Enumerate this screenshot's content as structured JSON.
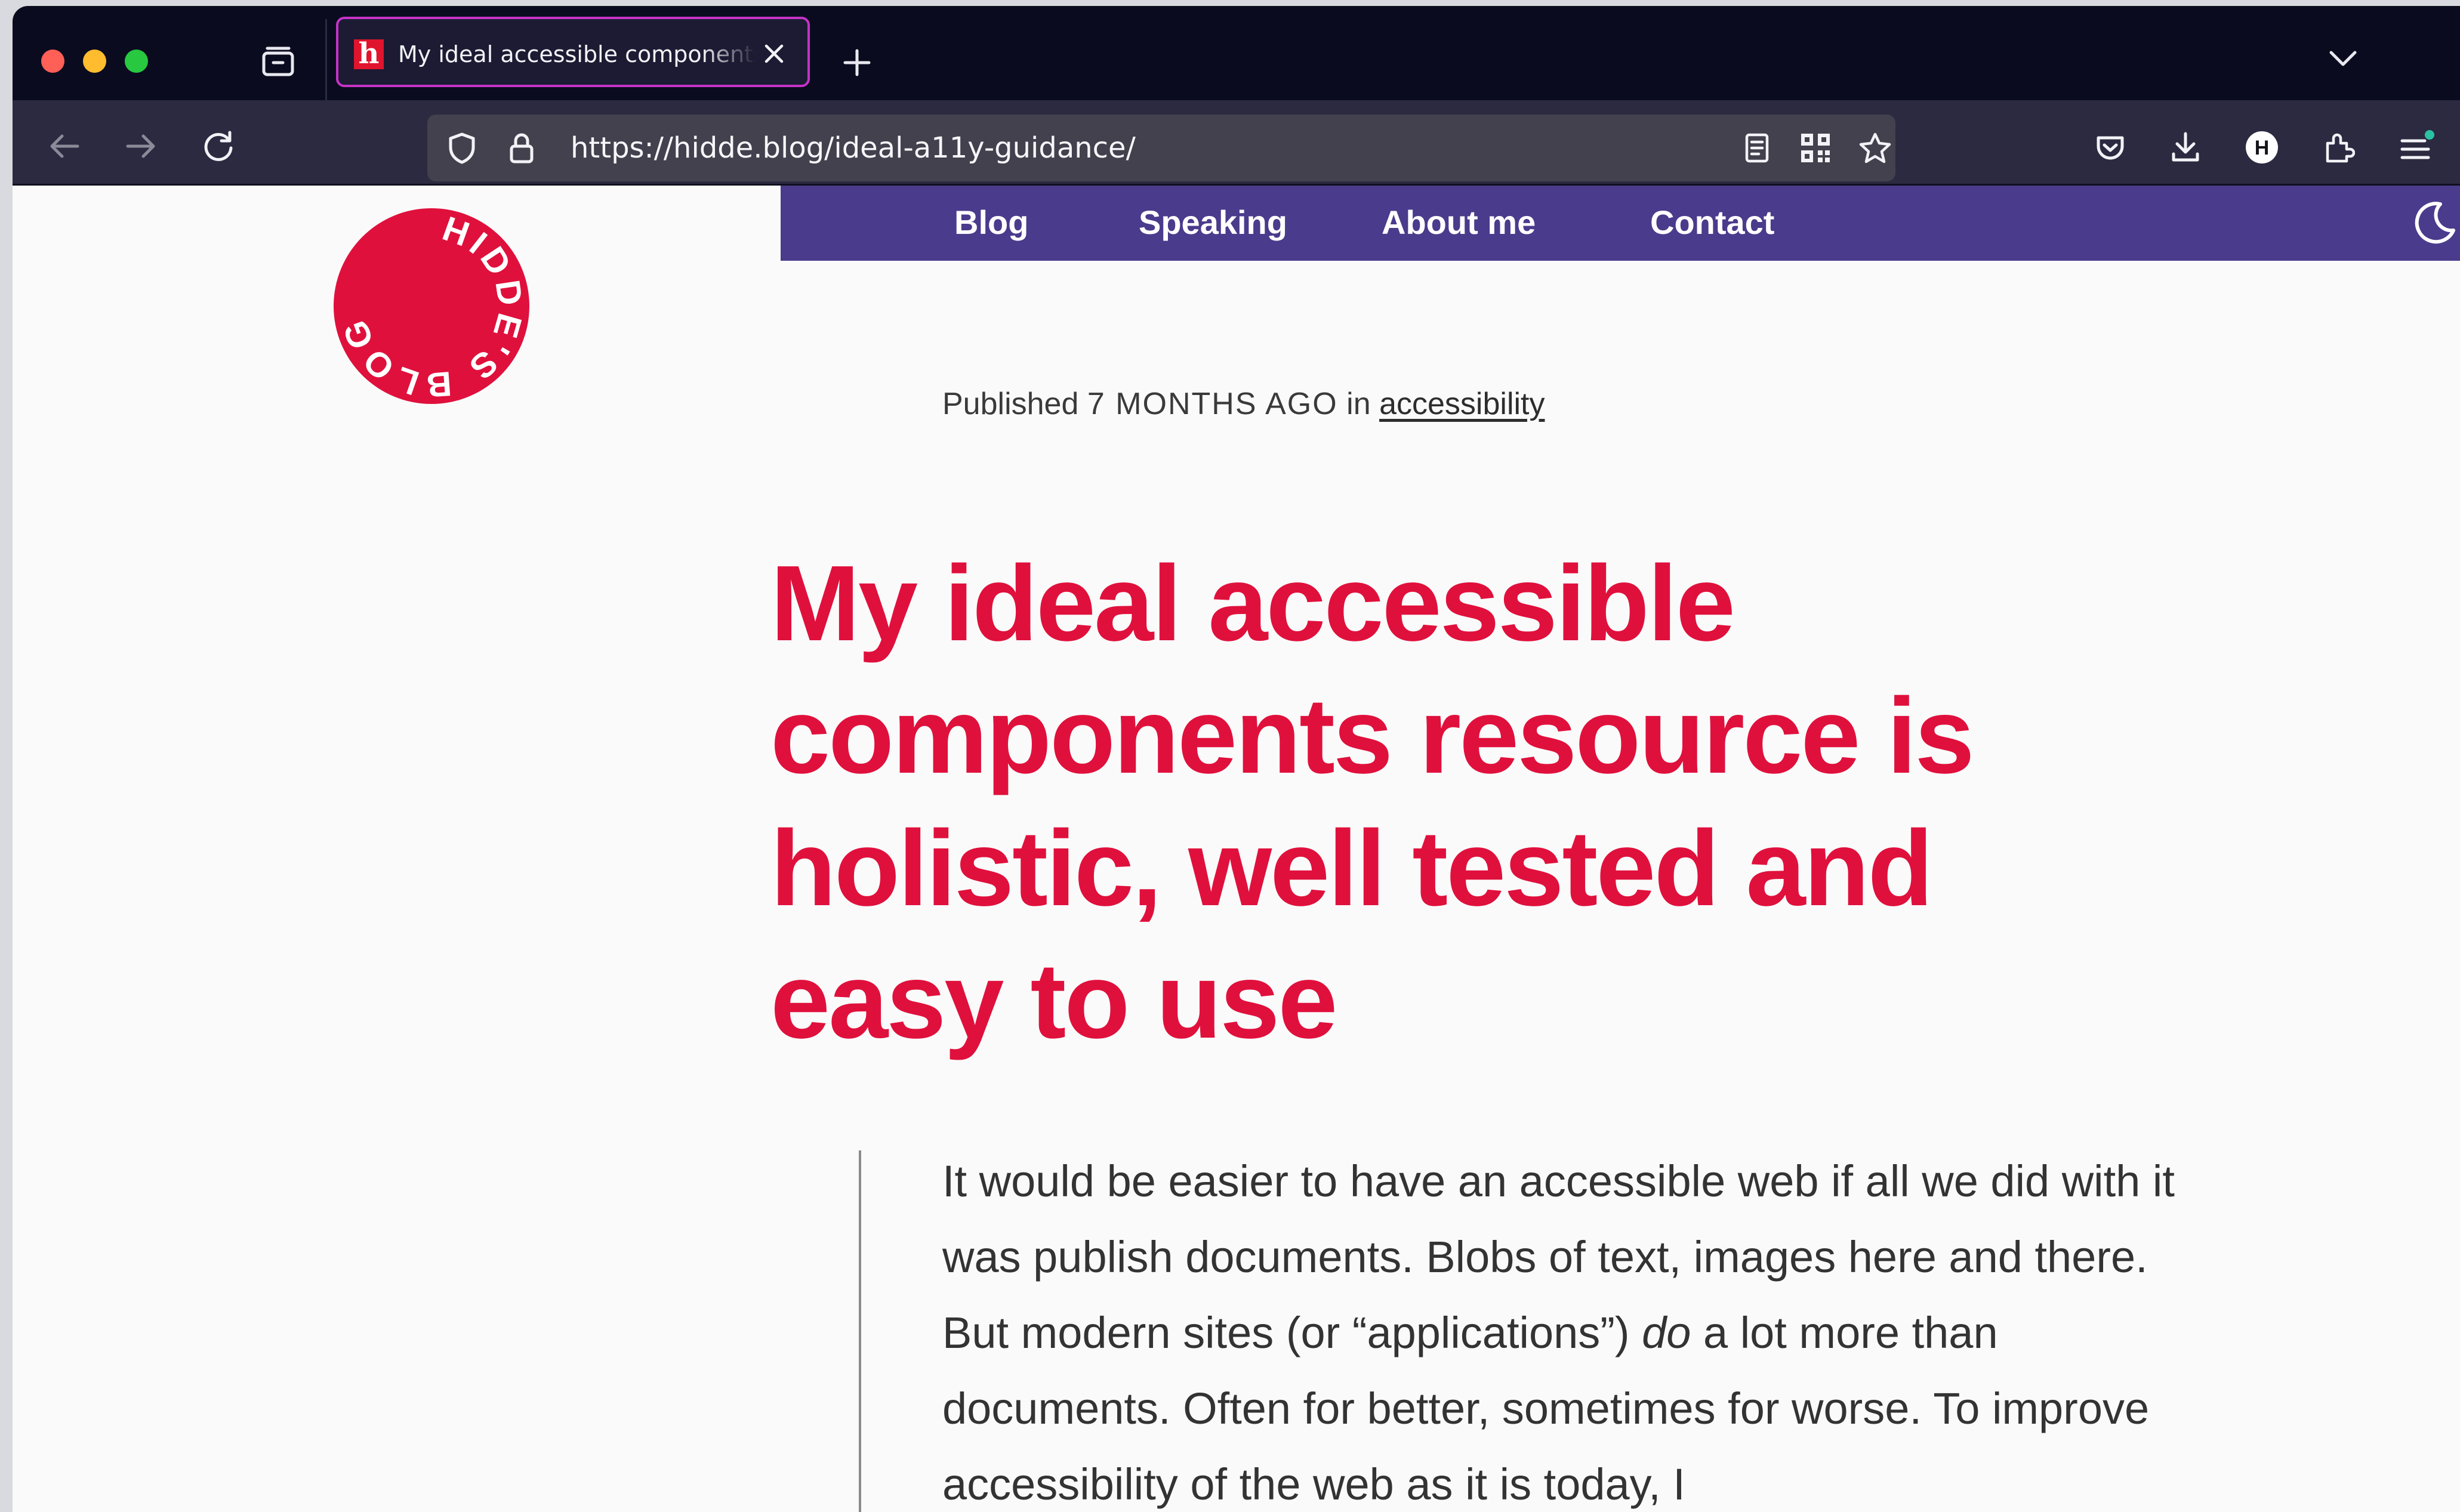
{
  "browser": {
    "tab": {
      "title": "My ideal accessible components resource is holistic, well tested and easy to use",
      "favicon_letter": "h"
    },
    "url": "https://hidde.blog/ideal-a11y-guidance/",
    "profile_initial": "H"
  },
  "site": {
    "nav": [
      "Blog",
      "Speaking",
      "About me",
      "Contact"
    ],
    "logo_text": "HIDDE'S BLOG",
    "accent": "#e0103c",
    "nav_bg": "#4a3b8c"
  },
  "article": {
    "meta": {
      "prefix": "Published",
      "when": "7 MONTHS AGO",
      "joiner": "in",
      "category": "accessibility"
    },
    "title": "My ideal accessible components resource is holistic, well tested and easy to use",
    "intro_part1": "It would be easier to have an accessible web if all we did with it was publish documents. Blobs of text, images here and there. But modern sites (or “applications”) ",
    "intro_em": "do",
    "intro_part2": " a lot more than documents. Often for better, sometimes for worse. To improve accessibility of the web as it is today, I"
  }
}
